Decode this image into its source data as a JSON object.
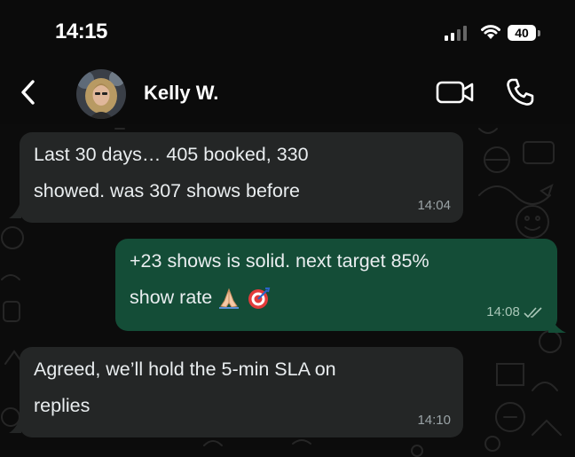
{
  "status_bar": {
    "time": "14:15",
    "battery": "40"
  },
  "header": {
    "contact_name": "Kelly W.",
    "back_icon": "chevron-left-icon",
    "video_icon": "video-camera-icon",
    "call_icon": "phone-icon"
  },
  "messages": [
    {
      "direction": "incoming",
      "lines": [
        "Last 30 days… 405 booked, 330",
        "showed. was 307 shows before"
      ],
      "time": "14:04"
    },
    {
      "direction": "outgoing",
      "lines": [
        "+23 shows is solid. next target 85%",
        "show rate"
      ],
      "emojis": [
        "folded-hands",
        "direct-hit"
      ],
      "time": "14:08",
      "status": "read"
    },
    {
      "direction": "incoming",
      "lines": [
        "Agreed, we’ll hold the 5-min SLA on",
        "replies"
      ],
      "time": "14:10"
    }
  ],
  "colors": {
    "incoming_bubble": "#242626",
    "outgoing_bubble": "#144d37",
    "background": "#0b0b0b"
  }
}
